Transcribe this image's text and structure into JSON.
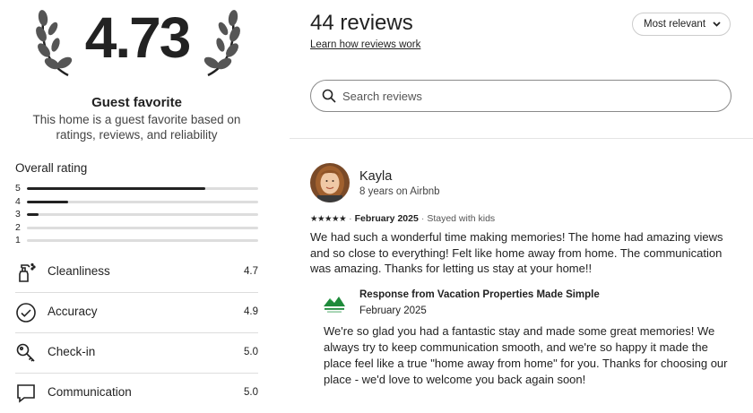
{
  "summary": {
    "rating": "4.73",
    "badge_title": "Guest favorite",
    "badge_description": "This home is a guest favorite based on ratings, reviews, and reliability"
  },
  "overall": {
    "label": "Overall rating",
    "distribution": [
      {
        "stars": "5",
        "fraction": 0.77
      },
      {
        "stars": "4",
        "fraction": 0.18
      },
      {
        "stars": "3",
        "fraction": 0.05
      },
      {
        "stars": "2",
        "fraction": 0.0
      },
      {
        "stars": "1",
        "fraction": 0.0
      }
    ]
  },
  "categories": [
    {
      "label": "Cleanliness",
      "value": "4.7",
      "icon": "spray-bottle-icon"
    },
    {
      "label": "Accuracy",
      "value": "4.9",
      "icon": "check-circle-icon"
    },
    {
      "label": "Check-in",
      "value": "5.0",
      "icon": "key-icon"
    },
    {
      "label": "Communication",
      "value": "5.0",
      "icon": "message-icon"
    }
  ],
  "reviews_header": {
    "title": "44 reviews",
    "learn_link": "Learn how reviews work",
    "sort_label": "Most relevant",
    "search_placeholder": "Search reviews"
  },
  "review": {
    "name": "Kayla",
    "tenure": "8 years on Airbnb",
    "stars": "★★★★★",
    "date": "February 2025",
    "stay_type": "Stayed with kids",
    "text": "We had such a wonderful time making memories! The home had amazing views and so close to everything! Felt like home away from home. The communication was amazing. Thanks for letting us stay at your home!!",
    "response": {
      "title": "Response from Vacation Properties Made Simple",
      "date": "February 2025",
      "text": "We're so glad you had a fantastic stay and made some great memories! We always try to keep communication smooth, and we're so happy it made the place feel like a true \"home away from home\" for you. Thanks for choosing our place - we'd love to welcome you back again soon!"
    }
  },
  "colors": {
    "text": "#222222",
    "bar_fill": "#222222",
    "bar_track": "#dddddd",
    "divider": "#dddddd",
    "host_logo": "#1e8a3a"
  }
}
